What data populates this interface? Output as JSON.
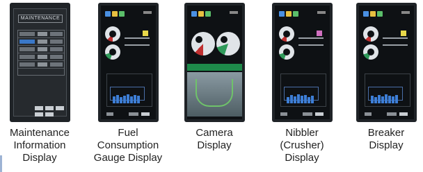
{
  "captions": {
    "maintenance": {
      "line1": "Maintenance",
      "line2": "Information",
      "line3": "Display"
    },
    "fuel": {
      "line1": "Fuel",
      "line2": "Consumption",
      "line3": "Gauge Display"
    },
    "camera": {
      "line1": "Camera",
      "line2": "Display"
    },
    "nibbler": {
      "line1": "Nibbler",
      "line2": "(Crusher)",
      "line3": "Display"
    },
    "breaker": {
      "line1": "Breaker",
      "line2": "Display"
    }
  },
  "maintenance_screen": {
    "title": "MAINTENANCE"
  },
  "icons": [
    "monitor-screen-icon",
    "gauge-icon",
    "camera-icon"
  ],
  "colors": {
    "highlight_blue": "#3a78c8",
    "bar_blue": "#3d7ed6",
    "camera_green": "#1e8a4a",
    "gauge_red": "#c03030",
    "gauge_green": "#2f9a5a",
    "nibbler_pink": "#d070c0",
    "indicator_yellow": "#e8d84a"
  }
}
